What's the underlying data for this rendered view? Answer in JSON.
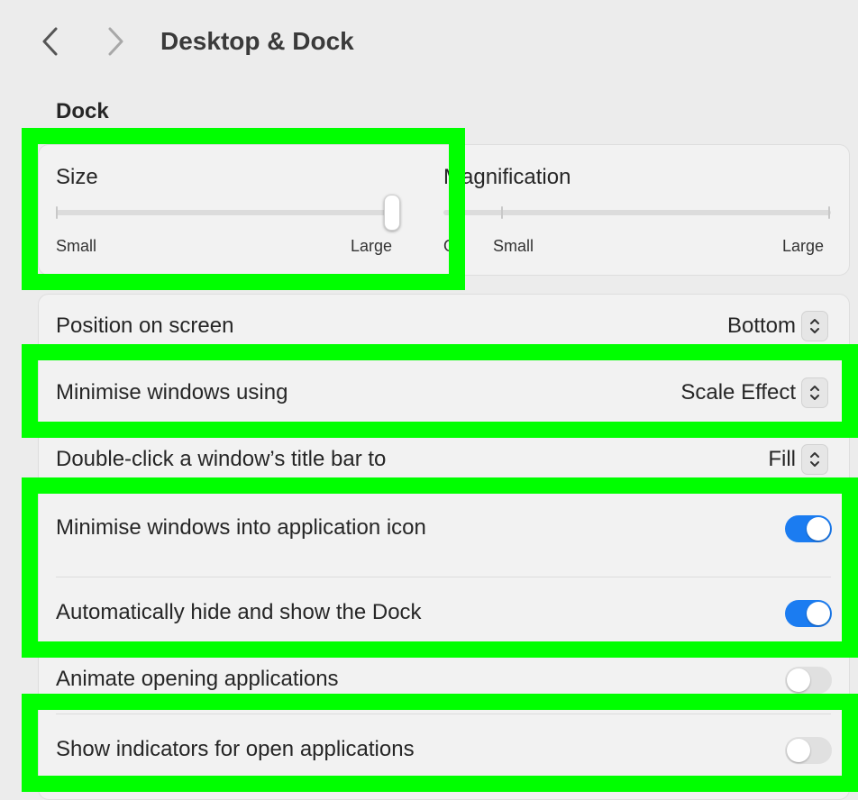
{
  "header": {
    "title": "Desktop & Dock"
  },
  "dock": {
    "section_title": "Dock",
    "size": {
      "label": "Size",
      "min_label": "Small",
      "max_label": "Large",
      "value": 1.0
    },
    "magnification": {
      "label": "Magnification",
      "off_label": "Off",
      "min_label": "Small",
      "max_label": "Large"
    },
    "rows": [
      {
        "label": "Position on screen",
        "value": "Bottom"
      },
      {
        "label": "Minimise windows using",
        "value": "Scale Effect"
      },
      {
        "label": "Double-click a window’s title bar to",
        "value": "Fill"
      },
      {
        "label": "Minimise windows into application icon",
        "enabled": true
      },
      {
        "label": "Automatically hide and show the Dock",
        "enabled": true
      },
      {
        "label": "Animate opening applications",
        "enabled": false
      },
      {
        "label": "Show indicators for open applications",
        "enabled": false
      }
    ]
  },
  "colors": {
    "highlight": "#00ff00",
    "toggle_on": "#1b7cf1",
    "toggle_off": "#e0e0e0"
  },
  "icons": {
    "back": "chevron-left-icon",
    "forward": "chevron-right-icon",
    "stepper": "up-down-chevron-icon"
  }
}
